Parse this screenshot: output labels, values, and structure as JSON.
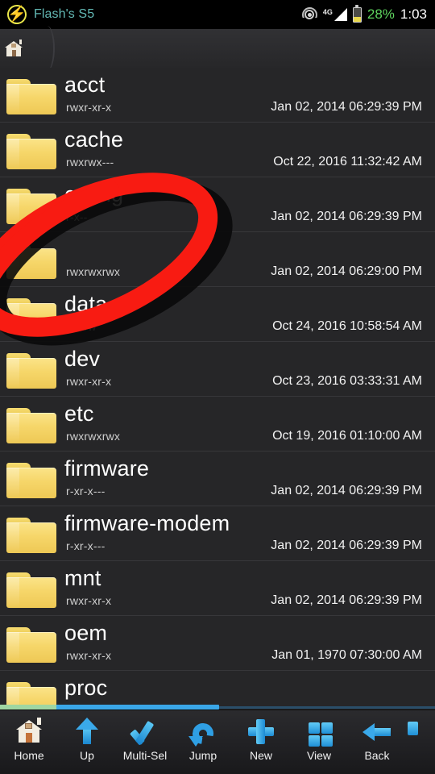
{
  "statusbar": {
    "logo_icon": "flash-bolt-logo",
    "carrier": "Flash's S5",
    "hotspot_icon": "hotspot-icon",
    "network_type": "4G",
    "signal_icon": "signal-bars-icon",
    "battery_icon": "battery-icon",
    "battery_percent": "28%",
    "clock": "1:03",
    "colors": {
      "carrier": "#63b9b5",
      "battery_text": "#5fd45f",
      "battery_fill": "#e8d84a",
      "clock": "#ffffff"
    }
  },
  "breadcrumb": {
    "home_icon": "home-icon",
    "separator_icon": "chevron-right-icon",
    "path_label": ""
  },
  "filelist": {
    "columns": [
      "name",
      "permissions",
      "modified"
    ],
    "rows": [
      {
        "icon": "folder-icon",
        "name": "acct",
        "permissions": "rwxr-xr-x",
        "modified": "Jan 02, 2014 06:29:39 PM"
      },
      {
        "icon": "folder-icon",
        "name": "cache",
        "permissions": "rwxrwx---",
        "modified": "Oct 22, 2016 11:32:42 AM"
      },
      {
        "icon": "folder-icon",
        "name": "config",
        "permissions": "r-x--",
        "modified": "Jan 02, 2014 06:29:39 PM"
      },
      {
        "icon": "folder-icon",
        "name": "",
        "permissions": "rwxrwxrwx",
        "modified": "Jan 02, 2014 06:29:00 PM"
      },
      {
        "icon": "folder-icon",
        "name": "data",
        "permissions": "rwxrw",
        "modified": "Oct 24, 2016 10:58:54 AM"
      },
      {
        "icon": "folder-icon",
        "name": "dev",
        "permissions": "rwxr-xr-x",
        "modified": "Oct 23, 2016 03:33:31 AM"
      },
      {
        "icon": "folder-icon",
        "name": "etc",
        "permissions": "rwxrwxrwx",
        "modified": "Oct 19, 2016 01:10:00 AM"
      },
      {
        "icon": "folder-icon",
        "name": "firmware",
        "permissions": "r-xr-x---",
        "modified": "Jan 02, 2014 06:29:39 PM"
      },
      {
        "icon": "folder-icon",
        "name": "firmware-modem",
        "permissions": "r-xr-x---",
        "modified": "Jan 02, 2014 06:29:39 PM"
      },
      {
        "icon": "folder-icon",
        "name": "mnt",
        "permissions": "rwxr-xr-x",
        "modified": "Jan 02, 2014 06:29:39 PM"
      },
      {
        "icon": "folder-icon",
        "name": "oem",
        "permissions": "rwxr-xr-x",
        "modified": "Jan 01, 1970 07:30:00 AM"
      },
      {
        "icon": "folder-icon",
        "name": "proc",
        "permissions": "",
        "modified": ""
      }
    ]
  },
  "annotation": {
    "shape": "red-ellipse-highlight",
    "target": "data",
    "color": "#f81b12"
  },
  "toolbar": {
    "items": [
      {
        "icon": "home-icon",
        "label": "Home"
      },
      {
        "icon": "arrow-up-icon",
        "label": "Up"
      },
      {
        "icon": "checkmark-icon",
        "label": "Multi-Sel"
      },
      {
        "icon": "curved-arrow-icon",
        "label": "Jump"
      },
      {
        "icon": "plus-icon",
        "label": "New"
      },
      {
        "icon": "grid-view-icon",
        "label": "View"
      },
      {
        "icon": "arrow-left-icon",
        "label": "Back"
      }
    ]
  },
  "scrollbar": {
    "orientation": "horizontal",
    "color": "#3aa7e8"
  }
}
